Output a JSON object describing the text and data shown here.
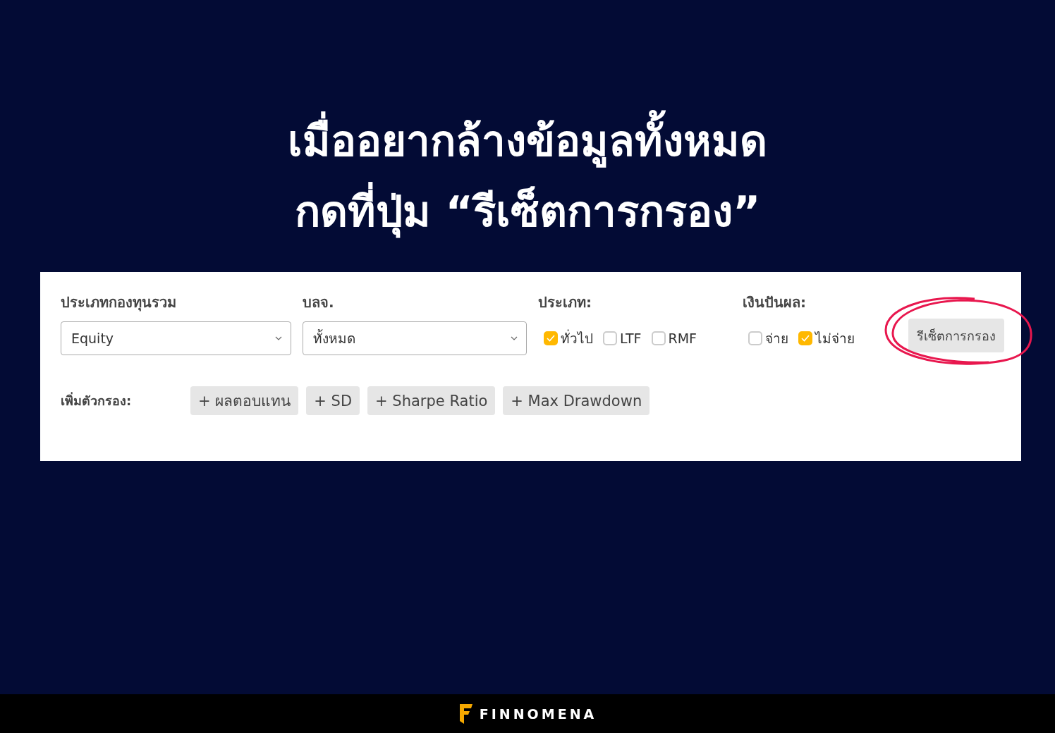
{
  "heading": [
    "เมื่ออยากล้างข้อมูลทั้งหมด",
    "กดที่ปุ่ม “รีเซ็ตการกรอง”"
  ],
  "filters": {
    "selects": [
      {
        "label": "ประเภทกองทุนรวม",
        "value": "Equity"
      },
      {
        "label": "บลจ.",
        "value": "ทั้งหมด"
      }
    ],
    "checkgroups": [
      {
        "label": "ประเภท:",
        "options": [
          {
            "label": "ทั่วไป",
            "checked": true
          },
          {
            "label": "LTF",
            "checked": false
          },
          {
            "label": "RMF",
            "checked": false
          }
        ]
      },
      {
        "label": "เงินปันผล:",
        "options": [
          {
            "label": "จ่าย",
            "checked": false
          },
          {
            "label": "ไม่จ่าย",
            "checked": true
          }
        ]
      }
    ],
    "reset_button": "รีเซ็ตการกรอง",
    "add_filter": {
      "label": "เพิ่มตัวกรอง:",
      "buttons": [
        "+ ผลตอบแทน",
        "+ SD",
        "+ Sharpe Ratio",
        "+ Max Drawdown"
      ]
    }
  },
  "footer": {
    "brand": "FINNOMENA"
  }
}
